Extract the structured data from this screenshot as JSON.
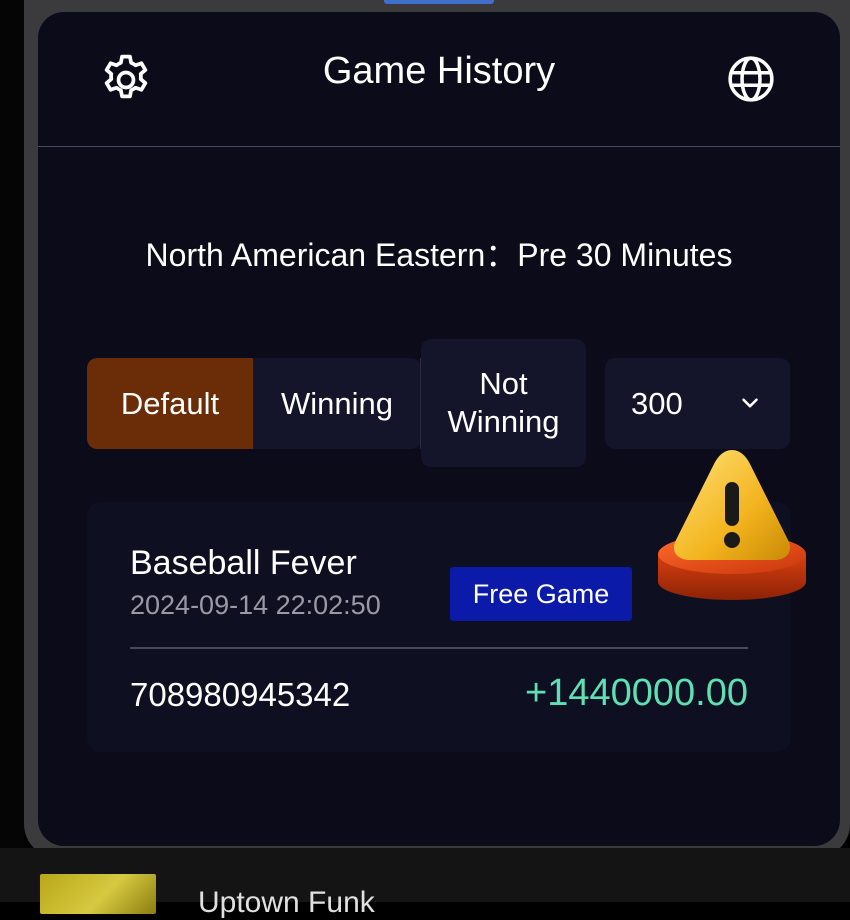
{
  "header": {
    "title": "Game History",
    "settings_icon": "gear-icon",
    "language_icon": "globe-icon"
  },
  "timezone_text": "North American Eastern：Pre 30 Minutes",
  "filters": {
    "tabs": [
      {
        "label": "Default",
        "selected": true
      },
      {
        "label": "Winning",
        "selected": false
      },
      {
        "label": "Not\nWinning",
        "selected": false
      }
    ],
    "count_select": {
      "value": "300"
    }
  },
  "records": [
    {
      "game_name": "Baseball Fever",
      "datetime": "2024-09-14 22:02:50",
      "badge": "Free Game",
      "order_id": "708980945342",
      "amount": "+1440000.00"
    }
  ],
  "overlay_icon": "warning-icon",
  "bottom_bar": {
    "text": "Uptown Funk"
  },
  "colors": {
    "panel_bg": "#0b0b1a",
    "selected_tab": "#6b2d08",
    "badge_bg": "#0b1aa8",
    "amount_positive": "#5fe0b4"
  }
}
